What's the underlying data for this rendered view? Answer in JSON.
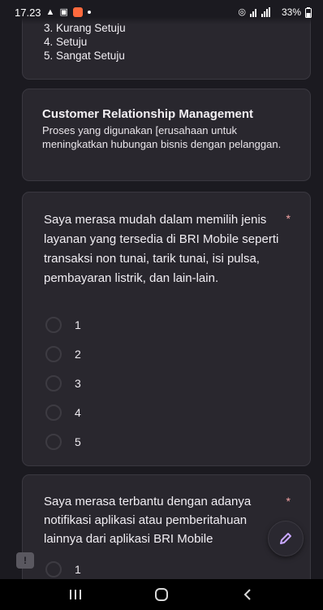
{
  "status_bar": {
    "time": "17.23",
    "right_text": "33%"
  },
  "scale_card": {
    "items": [
      "3. Kurang Setuju",
      "4. Setuju",
      "5. Sangat Setuju"
    ]
  },
  "section": {
    "title": "Customer Relationship Management",
    "description": "Proses yang digunakan [erusahaan untuk meningkatkan hubungan bisnis dengan pelanggan."
  },
  "question1": {
    "text": "Saya merasa mudah dalam memilih jenis layanan yang tersedia di BRI Mobile seperti transaksi non tunai, tarik tunai, isi pulsa, pembayaran listrik, dan lain-lain.",
    "required_mark": "*",
    "options": [
      "1",
      "2",
      "3",
      "4",
      "5"
    ]
  },
  "question2": {
    "text": "Saya merasa terbantu dengan adanya notifikasi aplikasi atau pemberitahuan lainnya dari aplikasi BRI Mobile",
    "required_mark": "*",
    "options": [
      "1"
    ]
  },
  "colors": {
    "background": "#1b1a20",
    "card": "#29272e",
    "required": "#f2a2a2",
    "fab_icon": "#c9a8ff"
  }
}
